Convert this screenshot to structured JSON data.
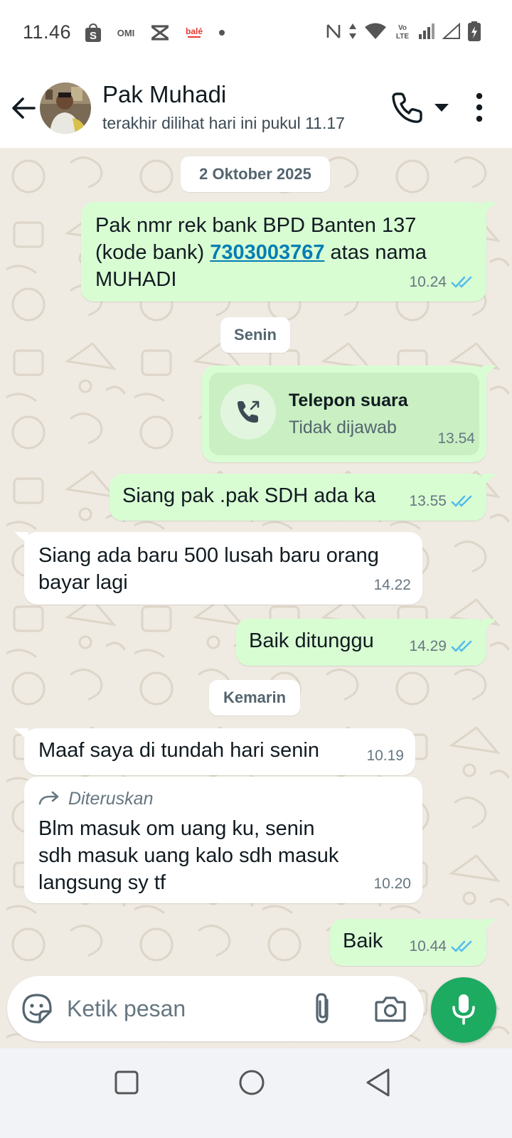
{
  "status_bar": {
    "time": "11.46",
    "left_icons": [
      "shopee-icon",
      "omi-icon",
      "xbox-like-icon",
      "bale-icon",
      "dot-icon"
    ],
    "right_icons": [
      "nfc-icon",
      "data-arrows-icon",
      "wifi-icon",
      "volte-icon",
      "signal-icon",
      "signal-empty-icon",
      "battery-charging-icon"
    ],
    "omi_text": "OMI",
    "volte_text": "Vo LTE"
  },
  "header": {
    "contact_name": "Pak Muhadi",
    "last_seen": "terakhir dilihat hari ini pukul 11.17"
  },
  "chat": {
    "date_1": "2 Oktober 2025",
    "msg_1": {
      "line1": "Pak nmr rek bank BPD Banten 137",
      "line2_pre": "(kode bank) ",
      "link": "7303003767",
      "line2_post": " atas nama",
      "line3": "MUHADI",
      "time": "10.24"
    },
    "date_2": "Senin",
    "call": {
      "title": "Telepon suara",
      "status": "Tidak dijawab",
      "time": "13.54"
    },
    "msg_2": {
      "text": "Siang pak .pak SDH ada ka",
      "time": "13.55"
    },
    "msg_3": {
      "line1": "Siang ada baru 500 lusah baru orang",
      "line2": "bayar lagi",
      "time": "14.22"
    },
    "msg_4": {
      "text": "Baik ditunggu",
      "time": "14.29"
    },
    "date_3": "Kemarin",
    "msg_5": {
      "text": "Maaf saya di tundah hari senin",
      "time": "10.19"
    },
    "msg_6": {
      "forward_label": "Diteruskan",
      "line1": "Blm masuk om uang ku, senin",
      "line2": "sdh masuk uang kalo sdh masuk",
      "line3": "langsung sy tf",
      "time": "10.20"
    },
    "msg_7": {
      "text": "Baik",
      "time": "10.44"
    }
  },
  "input": {
    "placeholder": "Ketik pesan"
  },
  "colors": {
    "outgoing_bubble": "#d9fdd3",
    "incoming_bubble": "#ffffff",
    "chat_bg": "#efeae2",
    "read_tick": "#53bdeb",
    "mic_button": "#1daa61",
    "link": "#027eb5"
  }
}
